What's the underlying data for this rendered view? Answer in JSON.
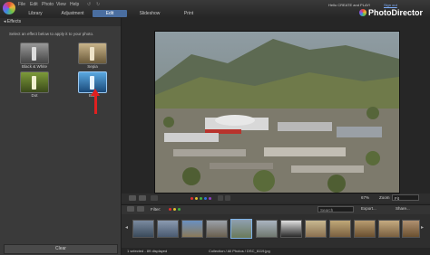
{
  "menu": [
    "File",
    "Edit",
    "Photo",
    "View",
    "Help"
  ],
  "tabs": [
    {
      "label": "Library",
      "active": false
    },
    {
      "label": "Adjustment",
      "active": false
    },
    {
      "label": "Edit",
      "active": true
    },
    {
      "label": "Slideshow",
      "active": false
    },
    {
      "label": "Print",
      "active": false
    }
  ],
  "header": {
    "greeting": "Hello CREATE and PLAY!",
    "sign_out": "Sign out",
    "brand": "PhotoDirector"
  },
  "panel": {
    "title": "Effects",
    "instruction": "Select an effect below to apply it to your photo.",
    "effects": [
      {
        "label": "Black & White"
      },
      {
        "label": "Sepia"
      },
      {
        "label": "Dot"
      },
      {
        "label": "Blur"
      }
    ],
    "clear_label": "Clear"
  },
  "viewer": {
    "zoom_label": "Zoom",
    "fit_label": "Fit",
    "zoom_value": "67%"
  },
  "filmstrip": {
    "filter_label": "Filter:",
    "search_placeholder": "Search",
    "export_label": "Export...",
    "share_label": "Share..."
  },
  "status": {
    "left": "1 selected - 89 displayed",
    "right": "Collection / All Photos / DSC_6119.jpg"
  },
  "colors": {
    "accent": "#4a6ea0",
    "arrow": "#e02020"
  }
}
